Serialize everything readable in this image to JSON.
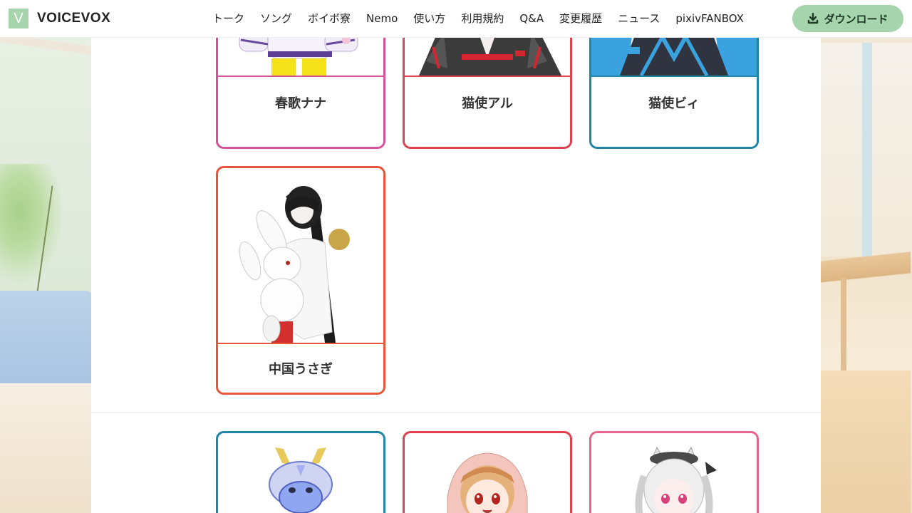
{
  "header": {
    "logo_letter": "V",
    "logo_text": "VOICEVOX",
    "nav": [
      "トーク",
      "ソング",
      "ボイボ寮",
      "Nemo",
      "使い方",
      "利用規約",
      "Q&A",
      "変更履歴",
      "ニュース",
      "pixivFANBOX"
    ],
    "download_label": "ダウンロード"
  },
  "characters_top": [
    {
      "name": "春歌ナナ",
      "color": "#d4529a"
    },
    {
      "name": "猫使アル",
      "color": "#e0414f"
    },
    {
      "name": "猫使ビィ",
      "color": "#1f86a8"
    }
  ],
  "characters_mid": [
    {
      "name": "中国うさぎ",
      "color": "#e8573a"
    }
  ],
  "characters_bottom": [
    {
      "color": "#1f86a8",
      "icon": "dragon-character-image"
    },
    {
      "color": "#e0414f",
      "icon": "hooded-girl-character-image"
    },
    {
      "color": "#e8658d",
      "icon": "cat-girl-character-image"
    }
  ],
  "colors": {
    "accent_green": "#a5d4ad",
    "panel_bg": "#ffffff"
  }
}
